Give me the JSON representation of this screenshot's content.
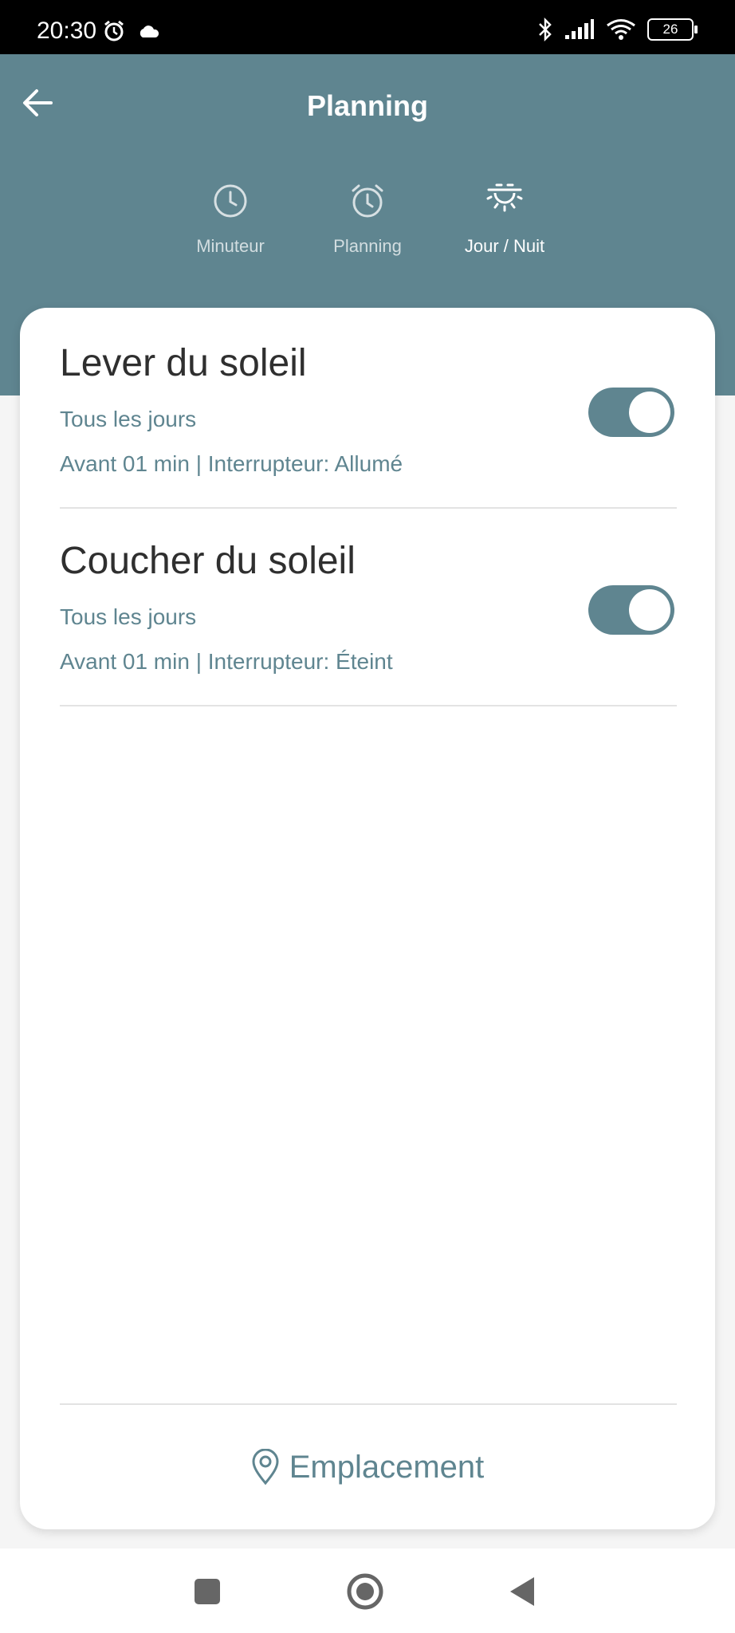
{
  "status_bar": {
    "time": "20:30",
    "battery": "26",
    "icons": [
      "alarm-icon",
      "cloud-icon",
      "bluetooth-icon",
      "signal-icon",
      "wifi-icon",
      "battery-icon"
    ]
  },
  "header": {
    "title": "Planning",
    "background": "#5f8590"
  },
  "tabs": [
    {
      "label": "Minuteur",
      "icon": "clock-icon",
      "active": false
    },
    {
      "label": "Planning",
      "icon": "alarm-clock-icon",
      "active": false
    },
    {
      "label": "Jour / Nuit",
      "icon": "sun-horizon-icon",
      "active": true
    }
  ],
  "schedules": [
    {
      "title": "Lever du soleil",
      "repeat": "Tous les jours",
      "detail": "Avant 01 min | Interrupteur: Allumé",
      "enabled": true
    },
    {
      "title": "Coucher du soleil",
      "repeat": "Tous les jours",
      "detail": "Avant 01 min | Interrupteur: Éteint",
      "enabled": true
    }
  ],
  "footer": {
    "location_label": "Emplacement"
  },
  "colors": {
    "accent": "#5f8590",
    "title_text": "#2f2f2f"
  }
}
